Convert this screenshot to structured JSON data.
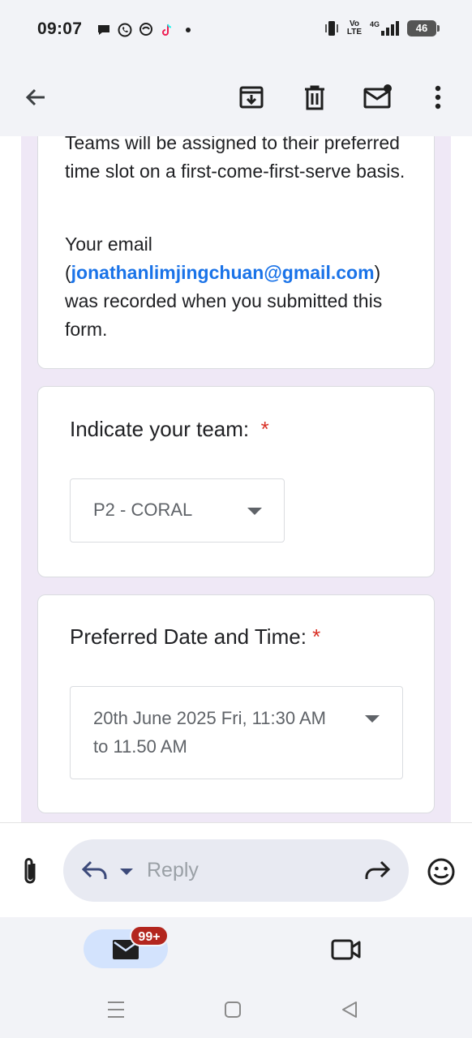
{
  "status_bar": {
    "time": "09:07",
    "battery": "46",
    "volte": "Vo LTE",
    "network": "4G"
  },
  "app_bar": {
    "back_icon": "arrow-left-icon",
    "archive_icon": "archive-icon",
    "delete_icon": "trash-icon",
    "mark_unread_icon": "mail-unread-icon",
    "more_icon": "more-vert-icon"
  },
  "form": {
    "intro_text": "Teams will be assigned to their preferred time slot on a first-come-first-serve basis.",
    "email_prefix": "Your email (",
    "email": "jonathanlimjingchuan@gmail.com",
    "email_suffix": ") was recorded when you submitted this form.",
    "q1_title": "Indicate your team:",
    "q1_required": "*",
    "q1_value": "P2 - CORAL",
    "q2_title": "Preferred Date and Time:",
    "q2_required": "*",
    "q2_value": "20th June 2025 Fri, 11:30 AM to 11.50 AM"
  },
  "reply_bar": {
    "placeholder": "Reply"
  },
  "bottom_nav": {
    "badge": "99+"
  },
  "colors": {
    "accent": "#1a73e8",
    "required": "#d93025",
    "badge": "#b3261e",
    "form_bg": "#efe8f6"
  }
}
